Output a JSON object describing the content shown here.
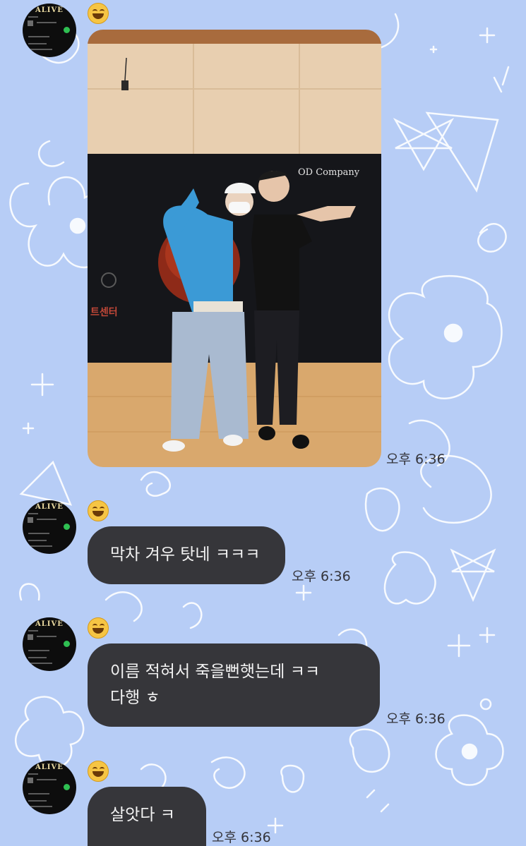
{
  "photo_text": {
    "brand": "OD Company",
    "banner_caption": "트센터"
  },
  "messages": [
    {
      "type": "photo",
      "time": "오후 6:36"
    },
    {
      "type": "text",
      "text": "막차 겨우 탓네 ㅋㅋㅋ",
      "time": "오후 6:36"
    },
    {
      "type": "text",
      "line1": "이름 적혀서 죽을뻔햇는데 ㅋㅋ",
      "line2": "다행 ㅎ",
      "time": "오후 6:36"
    },
    {
      "type": "text",
      "text": "살앗다 ㅋ",
      "time": "오후 6:36"
    }
  ],
  "avatar": {
    "title": "ALIVE"
  },
  "colors": {
    "background": "#b7cdf6",
    "bubble": "#36363a",
    "bubble_text": "#f2f2f2",
    "time_text": "#34343a"
  },
  "icons": [
    "profile-avatar",
    "smiling-face-emoji"
  ]
}
